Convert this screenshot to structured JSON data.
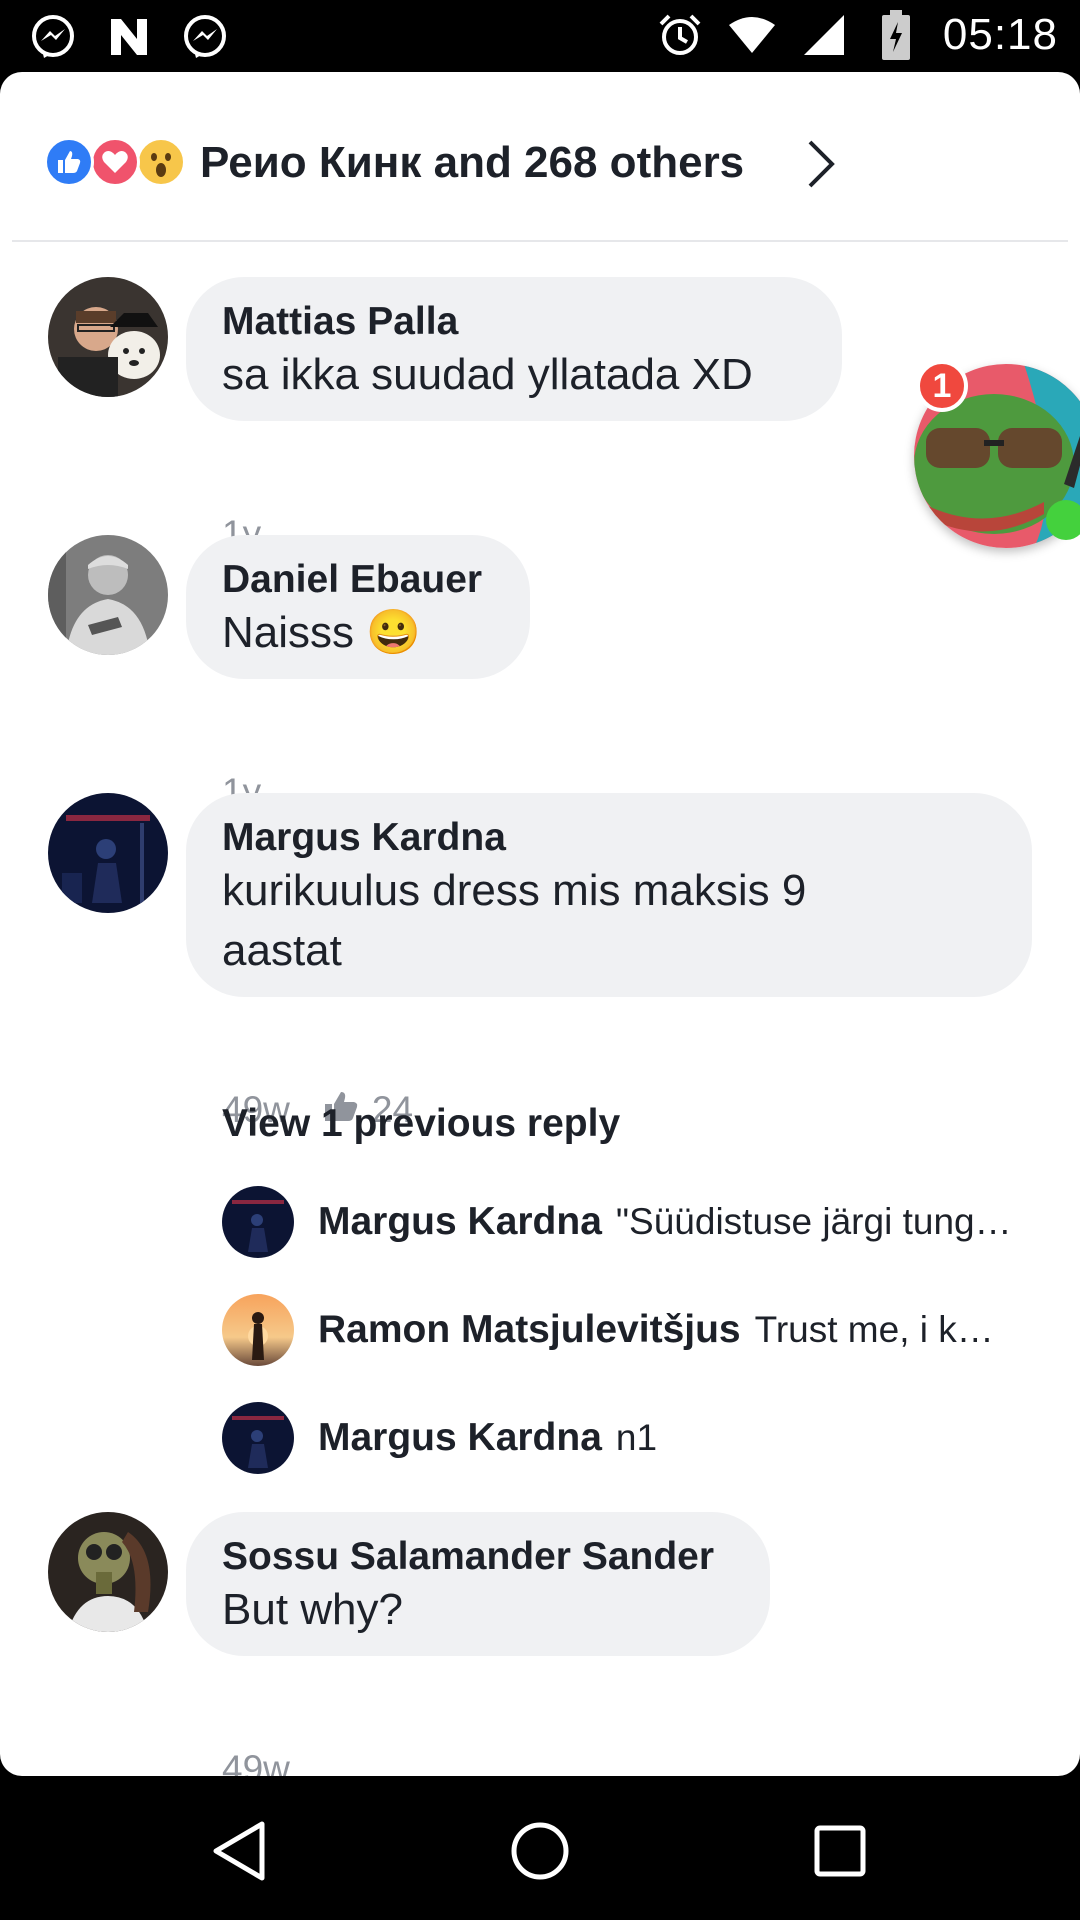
{
  "status_bar": {
    "time": "05:18",
    "left_icons": [
      "messenger-icon",
      "n-notification-icon",
      "messenger-icon"
    ],
    "right_icons": [
      "alarm-icon",
      "wifi-icon",
      "signal-icon",
      "battery-charging-icon"
    ]
  },
  "reactions": {
    "icons": [
      "like-icon",
      "love-icon",
      "wow-icon"
    ],
    "summary": "Реио Кинк and 268 others"
  },
  "comments": [
    {
      "author": "Mattias Palla",
      "text": "sa ikka suudad yllatada XD",
      "time": "1y"
    },
    {
      "author": "Daniel Ebauer",
      "text": "Naisss",
      "emoji": "😀",
      "time": "1y"
    },
    {
      "author": "Margus Kardna",
      "text": "kurikuulus dress mis maksis 9 aastat",
      "time": "49w",
      "likes": "24"
    },
    {
      "author": "Sossu Salamander Sander",
      "text": "But why?",
      "time": "49w"
    }
  ],
  "replies": {
    "view_previous": "View 1 previous reply",
    "items": [
      {
        "author": "Margus Kardna",
        "text": "\"Süüdistuse järgi tung…"
      },
      {
        "author": "Ramon Matsjulevitšjus",
        "text": "Trust me,  i k…"
      },
      {
        "author": "Margus Kardna",
        "text": "n1"
      }
    ]
  },
  "chat_head": {
    "badge": "1"
  },
  "colors": {
    "like_blue": "#2f7cf6",
    "love_red": "#f0536c",
    "wow_yellow": "#f7c64a",
    "badge_red": "#f0483e",
    "online_green": "#44d13d",
    "bubble_gray": "#f0f1f3"
  }
}
